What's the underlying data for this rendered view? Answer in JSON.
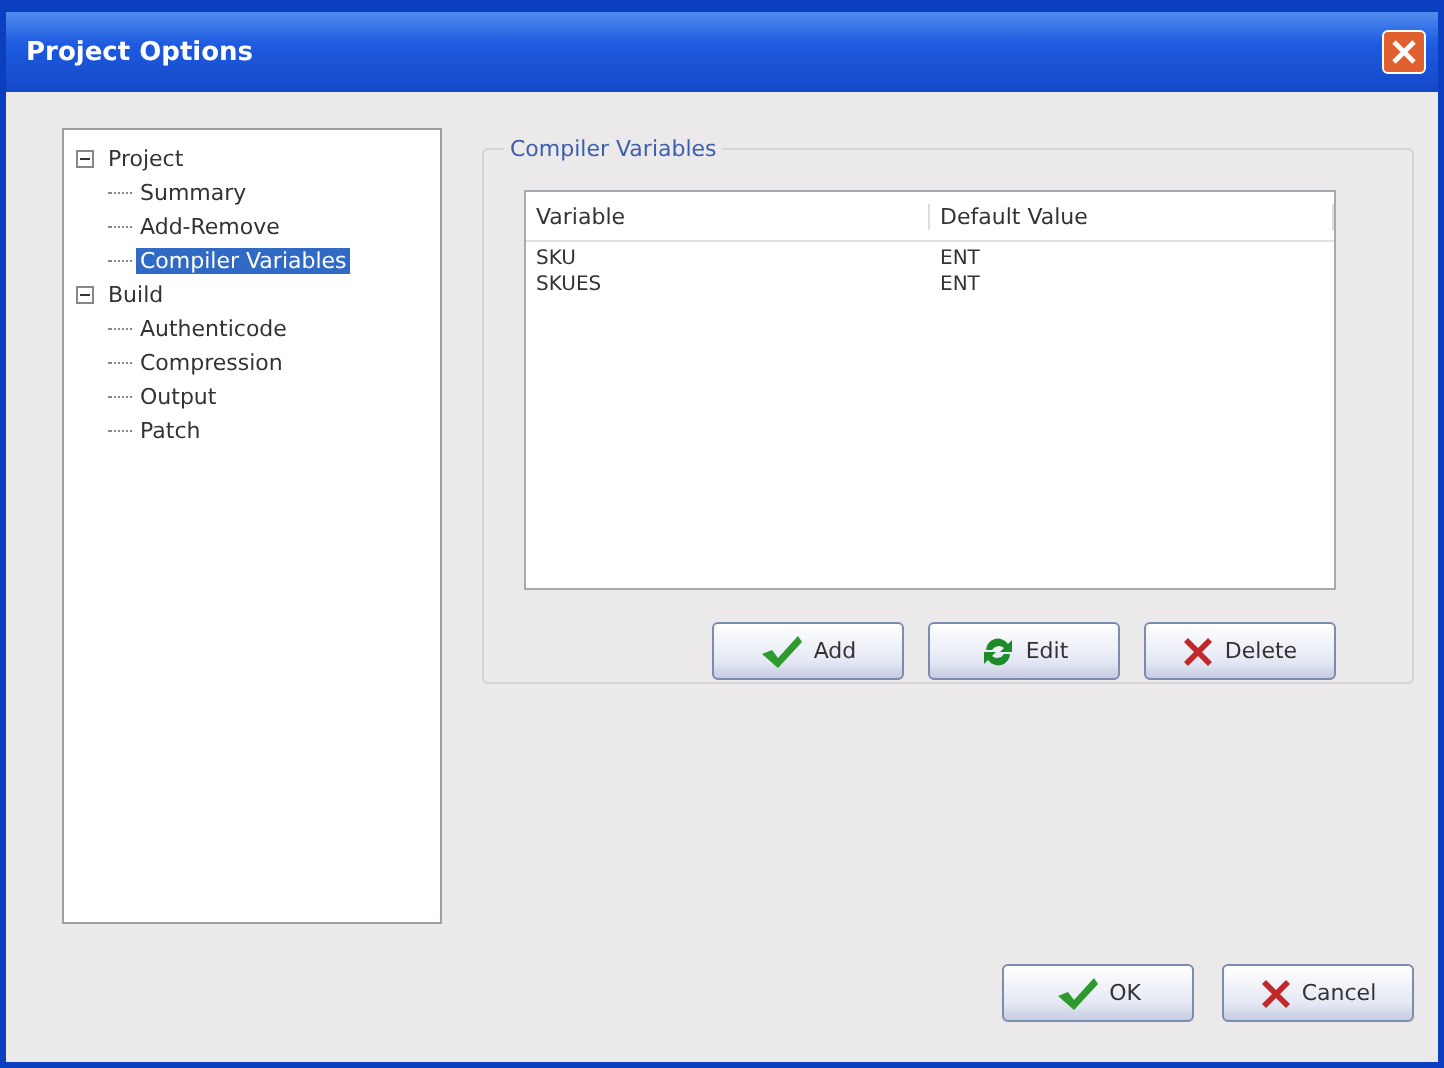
{
  "window": {
    "title": "Project Options"
  },
  "tree": [
    {
      "label": "Project",
      "expanded": true,
      "selected": false,
      "children": [
        {
          "label": "Summary",
          "selected": false
        },
        {
          "label": "Add-Remove",
          "selected": false
        },
        {
          "label": "Compiler Variables",
          "selected": true
        }
      ]
    },
    {
      "label": "Build",
      "expanded": true,
      "selected": false,
      "children": [
        {
          "label": "Authenticode",
          "selected": false
        },
        {
          "label": "Compression",
          "selected": false
        },
        {
          "label": "Output",
          "selected": false
        },
        {
          "label": "Patch",
          "selected": false
        }
      ]
    }
  ],
  "group": {
    "title": "Compiler Variables"
  },
  "table": {
    "columns": [
      "Variable",
      "Default Value"
    ],
    "rows": [
      [
        "SKU",
        "ENT"
      ],
      [
        "SKUES",
        "ENT"
      ]
    ]
  },
  "table_buttons": [
    {
      "label": "Add",
      "kind": "confirm"
    },
    {
      "label": "Edit",
      "kind": "modify"
    },
    {
      "label": "Delete",
      "kind": "remove"
    }
  ],
  "dialog_buttons": [
    {
      "label": "OK",
      "kind": "confirm"
    },
    {
      "label": "Cancel",
      "kind": "remove"
    }
  ]
}
